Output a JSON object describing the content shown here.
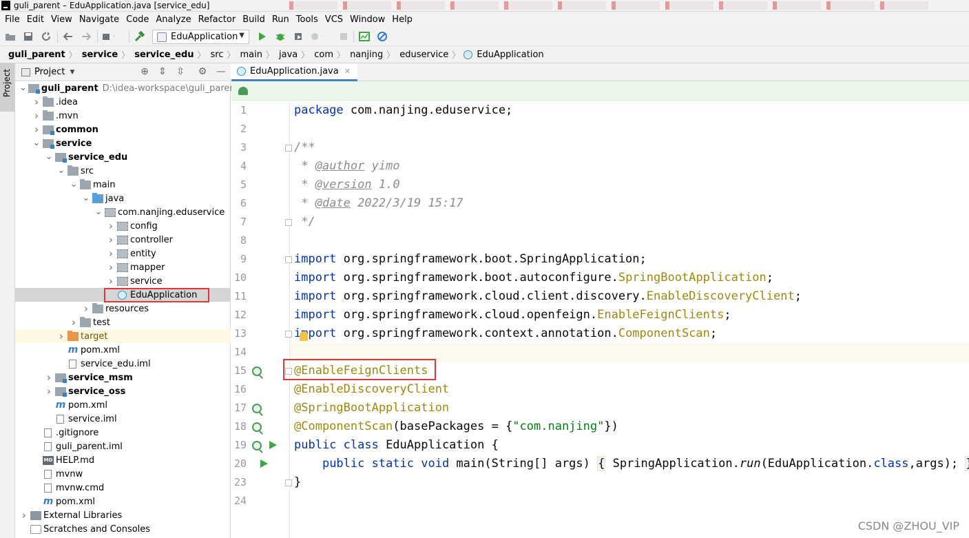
{
  "window": {
    "title": "guli_parent – EduApplication.java [service_edu]"
  },
  "menu": [
    "File",
    "Edit",
    "View",
    "Navigate",
    "Code",
    "Analyze",
    "Refactor",
    "Build",
    "Run",
    "Tools",
    "VCS",
    "Window",
    "Help"
  ],
  "toolbar": {
    "run_config": "EduApplication"
  },
  "navbar": {
    "crumbs": [
      "guli_parent",
      "service",
      "service_edu",
      "src",
      "main",
      "java",
      "com",
      "nanjing",
      "eduservice",
      "EduApplication"
    ]
  },
  "side_strip": {
    "project_tab": "Project"
  },
  "project_panel": {
    "title": "Project",
    "tree": [
      {
        "label": "guli_parent",
        "path": "D:\\idea-workspace\\guli_parent",
        "depth": 0,
        "expanded": true,
        "icon": "module",
        "bold": true
      },
      {
        "label": ".idea",
        "depth": 1,
        "expanded": false,
        "icon": "folder"
      },
      {
        "label": ".mvn",
        "depth": 1,
        "expanded": false,
        "icon": "folder"
      },
      {
        "label": "common",
        "depth": 1,
        "expanded": false,
        "icon": "module",
        "bold": true
      },
      {
        "label": "service",
        "depth": 1,
        "expanded": true,
        "icon": "module",
        "bold": true
      },
      {
        "label": "service_edu",
        "depth": 2,
        "expanded": true,
        "icon": "module",
        "bold": true
      },
      {
        "label": "src",
        "depth": 3,
        "expanded": true,
        "icon": "folder"
      },
      {
        "label": "main",
        "depth": 4,
        "expanded": true,
        "icon": "folder"
      },
      {
        "label": "java",
        "depth": 5,
        "expanded": true,
        "icon": "source"
      },
      {
        "label": "com.nanjing.eduservice",
        "depth": 6,
        "expanded": true,
        "icon": "package"
      },
      {
        "label": "config",
        "depth": 7,
        "expanded": false,
        "icon": "package"
      },
      {
        "label": "controller",
        "depth": 7,
        "expanded": false,
        "icon": "package"
      },
      {
        "label": "entity",
        "depth": 7,
        "expanded": false,
        "icon": "package"
      },
      {
        "label": "mapper",
        "depth": 7,
        "expanded": false,
        "icon": "package"
      },
      {
        "label": "service",
        "depth": 7,
        "expanded": false,
        "icon": "package"
      },
      {
        "label": "EduApplication",
        "depth": 7,
        "icon": "class",
        "selected": true
      },
      {
        "label": "resources",
        "depth": 5,
        "expanded": false,
        "icon": "folder"
      },
      {
        "label": "test",
        "depth": 4,
        "expanded": false,
        "icon": "folder"
      },
      {
        "label": "target",
        "depth": 3,
        "expanded": false,
        "icon": "orange",
        "excluded": true
      },
      {
        "label": "pom.xml",
        "depth": 3,
        "icon": "maven"
      },
      {
        "label": "service_edu.iml",
        "depth": 3,
        "icon": "file"
      },
      {
        "label": "service_msm",
        "depth": 2,
        "expanded": false,
        "icon": "module",
        "bold": true
      },
      {
        "label": "service_oss",
        "depth": 2,
        "expanded": false,
        "icon": "module",
        "bold": true
      },
      {
        "label": "pom.xml",
        "depth": 2,
        "icon": "maven"
      },
      {
        "label": "service.iml",
        "depth": 2,
        "icon": "file"
      },
      {
        "label": ".gitignore",
        "depth": 1,
        "icon": "file"
      },
      {
        "label": "guli_parent.iml",
        "depth": 1,
        "icon": "file"
      },
      {
        "label": "HELP.md",
        "depth": 1,
        "icon": "md"
      },
      {
        "label": "mvnw",
        "depth": 1,
        "icon": "file"
      },
      {
        "label": "mvnw.cmd",
        "depth": 1,
        "icon": "file"
      },
      {
        "label": "pom.xml",
        "depth": 1,
        "icon": "maven"
      },
      {
        "label": "External Libraries",
        "depth": 0,
        "expanded": false,
        "icon": "lib"
      },
      {
        "label": "Scratches and Consoles",
        "depth": 0,
        "icon": "scratch"
      }
    ]
  },
  "editor": {
    "tab_label": "EduApplication.java",
    "line_numbers": [
      "1",
      "2",
      "3",
      "4",
      "5",
      "6",
      "7",
      "8",
      "9",
      "10",
      "11",
      "12",
      "13",
      "14",
      "15",
      "16",
      "17",
      "18",
      "19",
      "20",
      "23",
      "24"
    ],
    "lines": [
      [
        {
          "t": "package",
          "c": "kw"
        },
        {
          "t": " com.nanjing.eduservice;"
        }
      ],
      [],
      [
        {
          "t": "/**",
          "c": "doc"
        }
      ],
      [
        {
          "t": " * ",
          "c": "doc"
        },
        {
          "t": "@author",
          "c": "doctag"
        },
        {
          "t": " yimo",
          "c": "doc"
        }
      ],
      [
        {
          "t": " * ",
          "c": "doc"
        },
        {
          "t": "@version",
          "c": "doctag"
        },
        {
          "t": " 1.0",
          "c": "doc"
        }
      ],
      [
        {
          "t": " * ",
          "c": "doc"
        },
        {
          "t": "@date",
          "c": "doctag"
        },
        {
          "t": " 2022/3/19 15:17",
          "c": "doc"
        }
      ],
      [
        {
          "t": " */",
          "c": "doc"
        }
      ],
      [],
      [
        {
          "t": "import",
          "c": "kw"
        },
        {
          "t": " org.springframework.boot.SpringApplication;"
        }
      ],
      [
        {
          "t": "import",
          "c": "kw"
        },
        {
          "t": " org.springframework.boot.autoconfigure."
        },
        {
          "t": "SpringBootApplication",
          "c": "ann"
        },
        {
          "t": ";"
        }
      ],
      [
        {
          "t": "import",
          "c": "kw"
        },
        {
          "t": " org.springframework.cloud.client.discovery."
        },
        {
          "t": "EnableDiscoveryClient",
          "c": "ann"
        },
        {
          "t": ";"
        }
      ],
      [
        {
          "t": "import",
          "c": "kw"
        },
        {
          "t": " org.springframework.cloud.openfeign."
        },
        {
          "t": "EnableFeignClients",
          "c": "ann"
        },
        {
          "t": ";"
        }
      ],
      [
        {
          "t": "import",
          "c": "kw"
        },
        {
          "t": " org.springframework.context.annotation."
        },
        {
          "t": "ComponentScan",
          "c": "ann"
        },
        {
          "t": ";"
        }
      ],
      [],
      [
        {
          "t": "@EnableFeignClients",
          "c": "ann"
        }
      ],
      [
        {
          "t": "@EnableDiscoveryClient",
          "c": "ann"
        }
      ],
      [
        {
          "t": "@SpringBootApplication",
          "c": "ann"
        }
      ],
      [
        {
          "t": "@ComponentScan",
          "c": "ann"
        },
        {
          "t": "(basePackages = {"
        },
        {
          "t": "\"com.nanjing\"",
          "c": "str"
        },
        {
          "t": "})"
        }
      ],
      [
        {
          "t": "public class",
          "c": "kw"
        },
        {
          "t": " EduApplication {"
        }
      ],
      [
        {
          "t": "    "
        },
        {
          "t": "public static void",
          "c": "kw"
        },
        {
          "t": " main(String[] args) "
        },
        {
          "t": "{",
          "c": "box"
        },
        {
          "t": " SpringApplication."
        },
        {
          "t": "run",
          "c": "italic"
        },
        {
          "t": "(EduApplication."
        },
        {
          "t": "class",
          "c": "kw"
        },
        {
          "t": ",args); "
        },
        {
          "t": "}",
          "c": "box"
        }
      ],
      [
        {
          "t": "}"
        }
      ],
      []
    ]
  },
  "watermark": "CSDN @ZHOU_VIP",
  "colors": {
    "keyword": "#0033b3",
    "annotation": "#9e880d",
    "string": "#067d17",
    "comment": "#8c8c8c",
    "highlight_box": "#e23636",
    "tab_underline": "#4083c9"
  }
}
